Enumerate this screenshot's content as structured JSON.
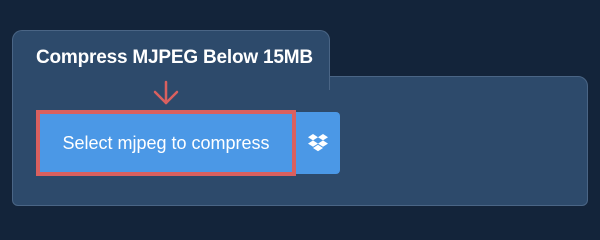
{
  "tab": {
    "title": "Compress MJPEG Below 15MB"
  },
  "upload": {
    "select_label": "Select mjpeg to compress",
    "dropbox_icon": "dropbox-icon",
    "pointer_icon": "arrow-down-icon"
  },
  "colors": {
    "background": "#13243a",
    "panel": "#2d4a6b",
    "button": "#4b98e6",
    "highlight": "#d9605f",
    "text": "#ffffff"
  }
}
